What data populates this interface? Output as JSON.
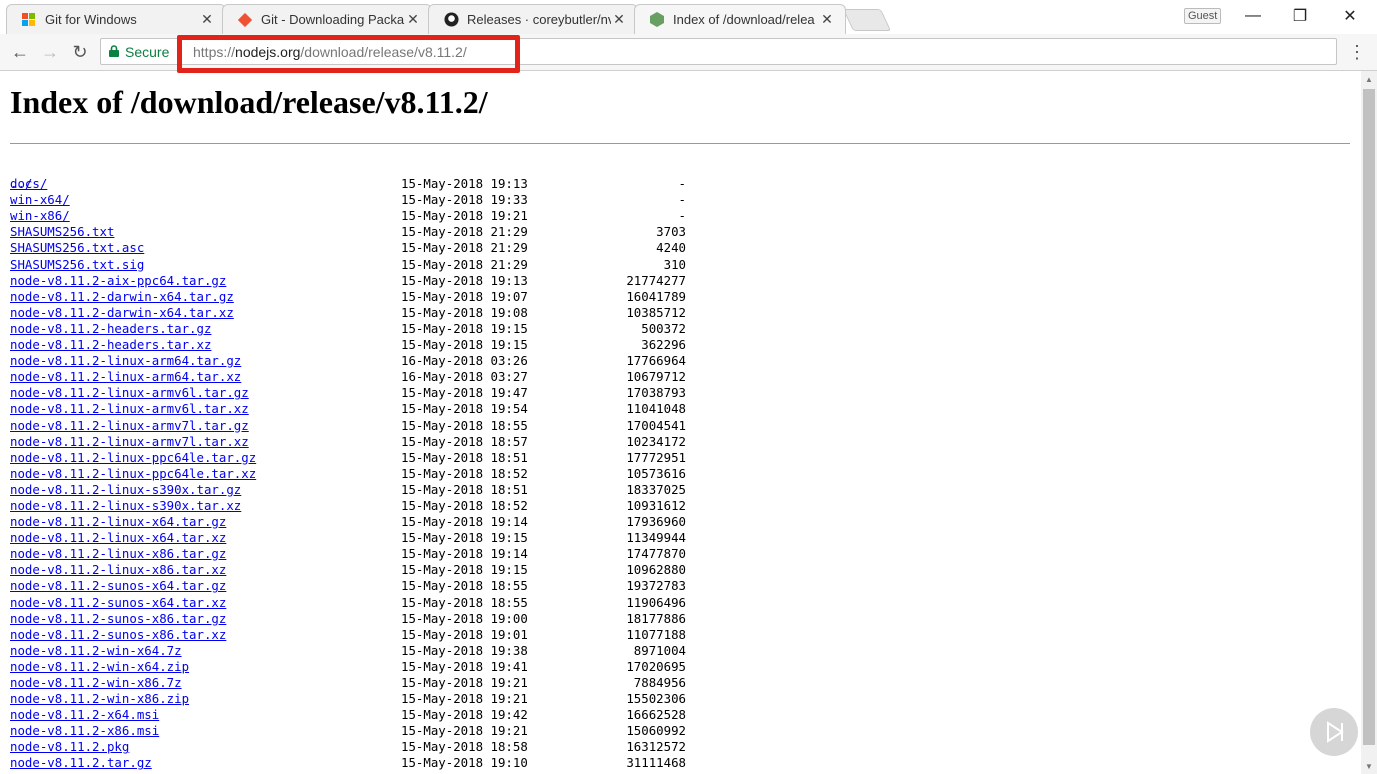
{
  "tabs": [
    {
      "title": "Git for Windows",
      "icon": "git-for-windows-icon"
    },
    {
      "title": "Git - Downloading Packa",
      "icon": "git-icon"
    },
    {
      "title": "Releases · coreybutler/nv",
      "icon": "github-icon"
    },
    {
      "title": "Index of /download/relea",
      "icon": "nodejs-icon"
    }
  ],
  "window": {
    "guest_label": "Guest"
  },
  "address_bar": {
    "secure_label": "Secure",
    "url_scheme": "https://",
    "url_host": "nodejs.org",
    "url_path": "/download/release/v8.11.2/"
  },
  "page": {
    "heading": "Index of /download/release/v8.11.2/",
    "parent_link": "../",
    "files": [
      {
        "name": "docs/",
        "date": "15-May-2018 19:13",
        "size": "-"
      },
      {
        "name": "win-x64/",
        "date": "15-May-2018 19:33",
        "size": "-"
      },
      {
        "name": "win-x86/",
        "date": "15-May-2018 19:21",
        "size": "-"
      },
      {
        "name": "SHASUMS256.txt",
        "date": "15-May-2018 21:29",
        "size": "3703"
      },
      {
        "name": "SHASUMS256.txt.asc",
        "date": "15-May-2018 21:29",
        "size": "4240"
      },
      {
        "name": "SHASUMS256.txt.sig",
        "date": "15-May-2018 21:29",
        "size": "310"
      },
      {
        "name": "node-v8.11.2-aix-ppc64.tar.gz",
        "date": "15-May-2018 19:13",
        "size": "21774277"
      },
      {
        "name": "node-v8.11.2-darwin-x64.tar.gz",
        "date": "15-May-2018 19:07",
        "size": "16041789"
      },
      {
        "name": "node-v8.11.2-darwin-x64.tar.xz",
        "date": "15-May-2018 19:08",
        "size": "10385712"
      },
      {
        "name": "node-v8.11.2-headers.tar.gz",
        "date": "15-May-2018 19:15",
        "size": "500372"
      },
      {
        "name": "node-v8.11.2-headers.tar.xz",
        "date": "15-May-2018 19:15",
        "size": "362296"
      },
      {
        "name": "node-v8.11.2-linux-arm64.tar.gz",
        "date": "16-May-2018 03:26",
        "size": "17766964"
      },
      {
        "name": "node-v8.11.2-linux-arm64.tar.xz",
        "date": "16-May-2018 03:27",
        "size": "10679712"
      },
      {
        "name": "node-v8.11.2-linux-armv6l.tar.gz",
        "date": "15-May-2018 19:47",
        "size": "17038793"
      },
      {
        "name": "node-v8.11.2-linux-armv6l.tar.xz",
        "date": "15-May-2018 19:54",
        "size": "11041048"
      },
      {
        "name": "node-v8.11.2-linux-armv7l.tar.gz",
        "date": "15-May-2018 18:55",
        "size": "17004541"
      },
      {
        "name": "node-v8.11.2-linux-armv7l.tar.xz",
        "date": "15-May-2018 18:57",
        "size": "10234172"
      },
      {
        "name": "node-v8.11.2-linux-ppc64le.tar.gz",
        "date": "15-May-2018 18:51",
        "size": "17772951"
      },
      {
        "name": "node-v8.11.2-linux-ppc64le.tar.xz",
        "date": "15-May-2018 18:52",
        "size": "10573616"
      },
      {
        "name": "node-v8.11.2-linux-s390x.tar.gz",
        "date": "15-May-2018 18:51",
        "size": "18337025"
      },
      {
        "name": "node-v8.11.2-linux-s390x.tar.xz",
        "date": "15-May-2018 18:52",
        "size": "10931612"
      },
      {
        "name": "node-v8.11.2-linux-x64.tar.gz",
        "date": "15-May-2018 19:14",
        "size": "17936960"
      },
      {
        "name": "node-v8.11.2-linux-x64.tar.xz",
        "date": "15-May-2018 19:15",
        "size": "11349944"
      },
      {
        "name": "node-v8.11.2-linux-x86.tar.gz",
        "date": "15-May-2018 19:14",
        "size": "17477870"
      },
      {
        "name": "node-v8.11.2-linux-x86.tar.xz",
        "date": "15-May-2018 19:15",
        "size": "10962880"
      },
      {
        "name": "node-v8.11.2-sunos-x64.tar.gz",
        "date": "15-May-2018 18:55",
        "size": "19372783"
      },
      {
        "name": "node-v8.11.2-sunos-x64.tar.xz",
        "date": "15-May-2018 18:55",
        "size": "11906496"
      },
      {
        "name": "node-v8.11.2-sunos-x86.tar.gz",
        "date": "15-May-2018 19:00",
        "size": "18177886"
      },
      {
        "name": "node-v8.11.2-sunos-x86.tar.xz",
        "date": "15-May-2018 19:01",
        "size": "11077188"
      },
      {
        "name": "node-v8.11.2-win-x64.7z",
        "date": "15-May-2018 19:38",
        "size": "8971004"
      },
      {
        "name": "node-v8.11.2-win-x64.zip",
        "date": "15-May-2018 19:41",
        "size": "17020695"
      },
      {
        "name": "node-v8.11.2-win-x86.7z",
        "date": "15-May-2018 19:21",
        "size": "7884956"
      },
      {
        "name": "node-v8.11.2-win-x86.zip",
        "date": "15-May-2018 19:21",
        "size": "15502306"
      },
      {
        "name": "node-v8.11.2-x64.msi",
        "date": "15-May-2018 19:42",
        "size": "16662528"
      },
      {
        "name": "node-v8.11.2-x86.msi",
        "date": "15-May-2018 19:21",
        "size": "15060992"
      },
      {
        "name": "node-v8.11.2.pkg",
        "date": "15-May-2018 18:58",
        "size": "16312572"
      },
      {
        "name": "node-v8.11.2.tar.gz",
        "date": "15-May-2018 19:10",
        "size": "31111468"
      }
    ]
  },
  "colors": {
    "link": "#0000ee",
    "highlight_box": "#e2231a",
    "secure_green": "#0b8043"
  }
}
